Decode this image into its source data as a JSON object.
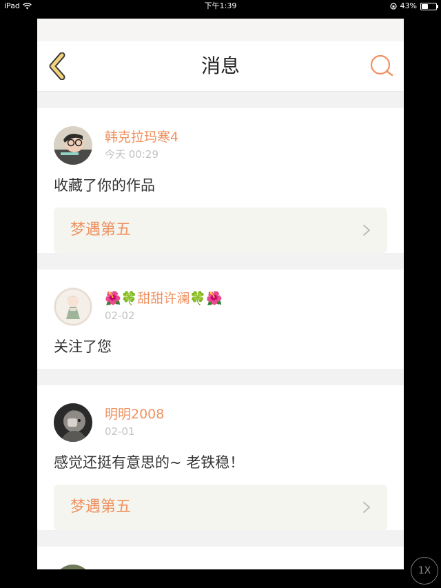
{
  "status_bar": {
    "device": "iPad",
    "time": "下午1:39",
    "battery_percent_text": "43%",
    "battery_level": 0.43
  },
  "header": {
    "title": "消息",
    "back_icon": "chevron-left-icon",
    "search_icon": "search-icon"
  },
  "colors": {
    "accent": "#ef9160",
    "back_icon_yellow": "#f2d27a",
    "back_icon_outline": "#3b3b3b",
    "link_bg": "#f5f5f0"
  },
  "messages": [
    {
      "username": "韩克拉玛寒4",
      "time": "今天 00:29",
      "text": "收藏了你的作品",
      "work_title": "梦遇第五"
    },
    {
      "username": "🌺🍀甜甜许澜🍀🌺",
      "time": "02-02",
      "text": "关注了您"
    },
    {
      "username": "明明2008",
      "time": "02-01",
      "text": "感觉还挺有意思的~ 老铁稳！",
      "work_title": "梦遇第五"
    }
  ],
  "zoom_badge": "1X"
}
